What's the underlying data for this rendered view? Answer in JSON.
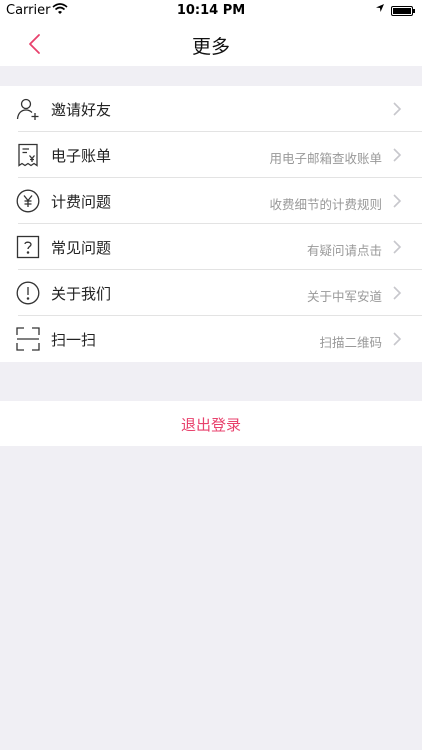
{
  "status_bar": {
    "carrier": "Carrier",
    "time": "10:14 PM"
  },
  "nav": {
    "title": "更多",
    "accent_color": "#e8416c"
  },
  "menu": {
    "items": [
      {
        "label": "邀请好友",
        "hint": "",
        "icon": "add-user-icon"
      },
      {
        "label": "电子账单",
        "hint": "用电子邮箱查收账单",
        "icon": "receipt-icon"
      },
      {
        "label": "计费问题",
        "hint": "收费细节的计费规则",
        "icon": "yen-icon"
      },
      {
        "label": "常见问题",
        "hint": "有疑问请点击",
        "icon": "question-icon"
      },
      {
        "label": "关于我们",
        "hint": "关于中军安道",
        "icon": "info-icon"
      },
      {
        "label": "扫一扫",
        "hint": "扫描二维码",
        "icon": "scan-icon"
      }
    ]
  },
  "logout": {
    "label": "退出登录",
    "color": "#e8416c"
  }
}
